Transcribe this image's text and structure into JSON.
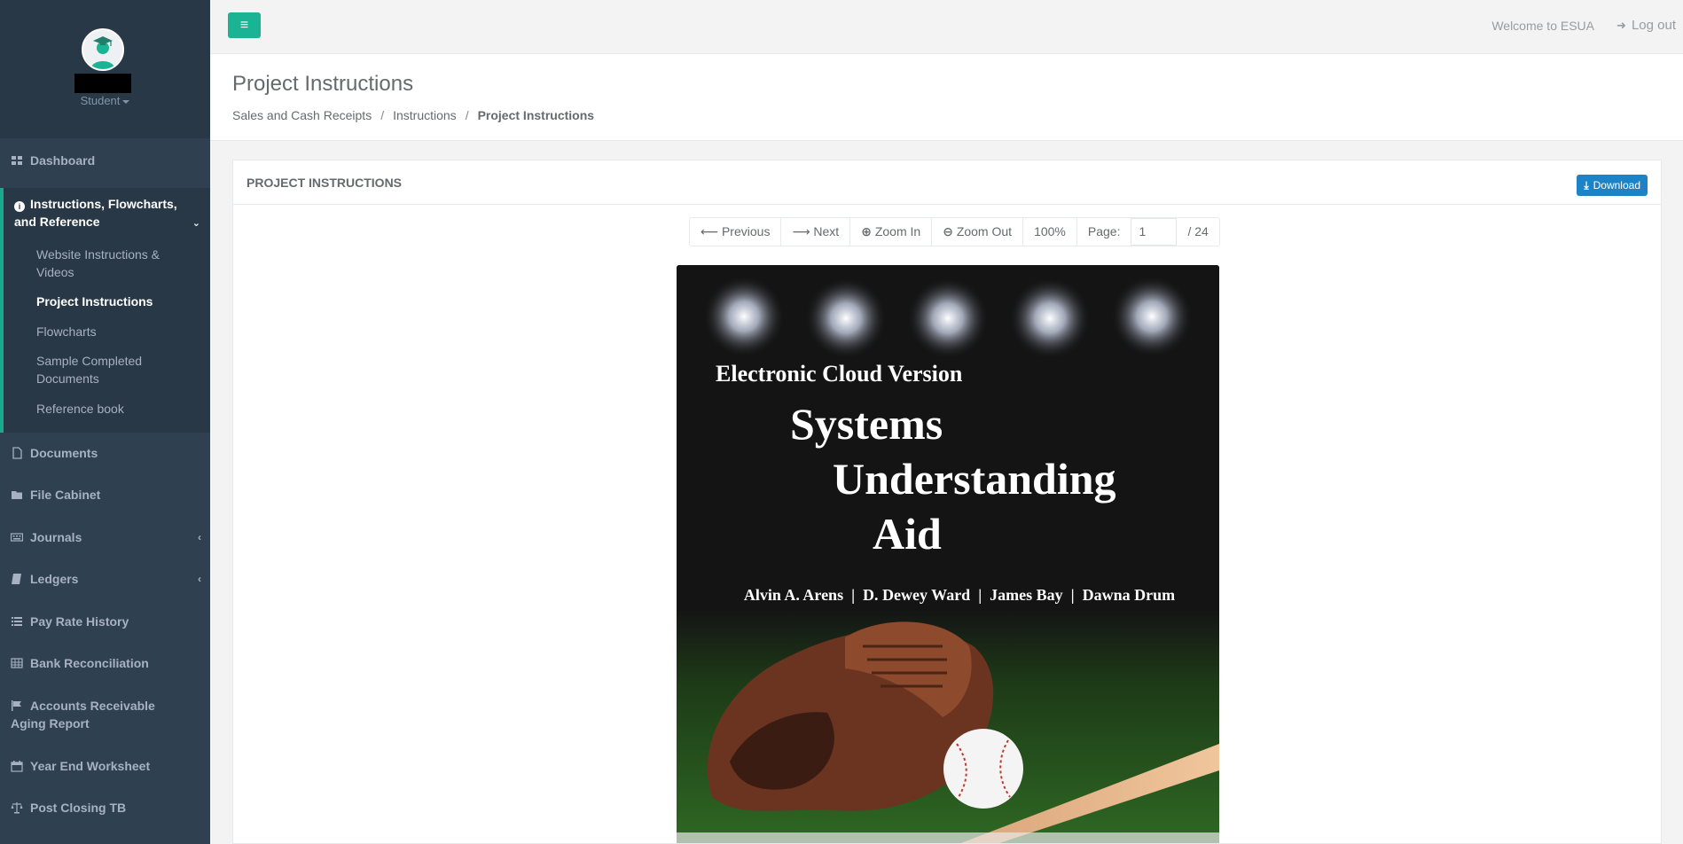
{
  "sidebar": {
    "role": "Student",
    "items": [
      {
        "label": "Dashboard",
        "icon": "dashboard-icon"
      },
      {
        "label": "Instructions, Flowcharts, and Reference",
        "icon": "info-icon"
      },
      {
        "label": "Documents",
        "icon": "file-icon"
      },
      {
        "label": "File Cabinet",
        "icon": "folder-icon"
      },
      {
        "label": "Journals",
        "icon": "keyboard-icon"
      },
      {
        "label": "Ledgers",
        "icon": "book-icon"
      },
      {
        "label": "Pay Rate History",
        "icon": "list-icon"
      },
      {
        "label": "Bank Reconciliation",
        "icon": "table-icon"
      },
      {
        "label": "Accounts Receivable Aging Report",
        "icon": "flag-icon"
      },
      {
        "label": "Year End Worksheet",
        "icon": "calendar-icon"
      },
      {
        "label": "Post Closing TB",
        "icon": "balance-scale-icon"
      }
    ],
    "subitems": [
      {
        "label": "Website Instructions & Videos"
      },
      {
        "label": "Project Instructions"
      },
      {
        "label": "Flowcharts"
      },
      {
        "label": "Sample Completed Documents"
      },
      {
        "label": "Reference book"
      }
    ]
  },
  "topbar": {
    "welcome": "Welcome to ESUA",
    "logout": "Log out"
  },
  "heading": {
    "title": "Project Instructions",
    "breadcrumb": [
      "Sales and Cash Receipts",
      "Instructions",
      "Project Instructions"
    ]
  },
  "panel": {
    "title": "PROJECT INSTRUCTIONS",
    "download": "Download"
  },
  "pdf_toolbar": {
    "previous": "Previous",
    "next": "Next",
    "zoom_in": "Zoom In",
    "zoom_out": "Zoom Out",
    "zoom_level": "100%",
    "page_label": "Page:",
    "page_value": "1",
    "page_total": "/ 24"
  },
  "cover": {
    "version": "Electronic Cloud Version",
    "title_line1": "Systems",
    "title_line2": "Understanding",
    "title_line3": "Aid",
    "authors": "Alvin A. Arens  |  D. Dewey Ward  |  James Bay  |  Dawna Drum"
  },
  "colors": {
    "sidebar": "#2f4050",
    "accent": "#1ab394",
    "download": "#1c84c6"
  }
}
